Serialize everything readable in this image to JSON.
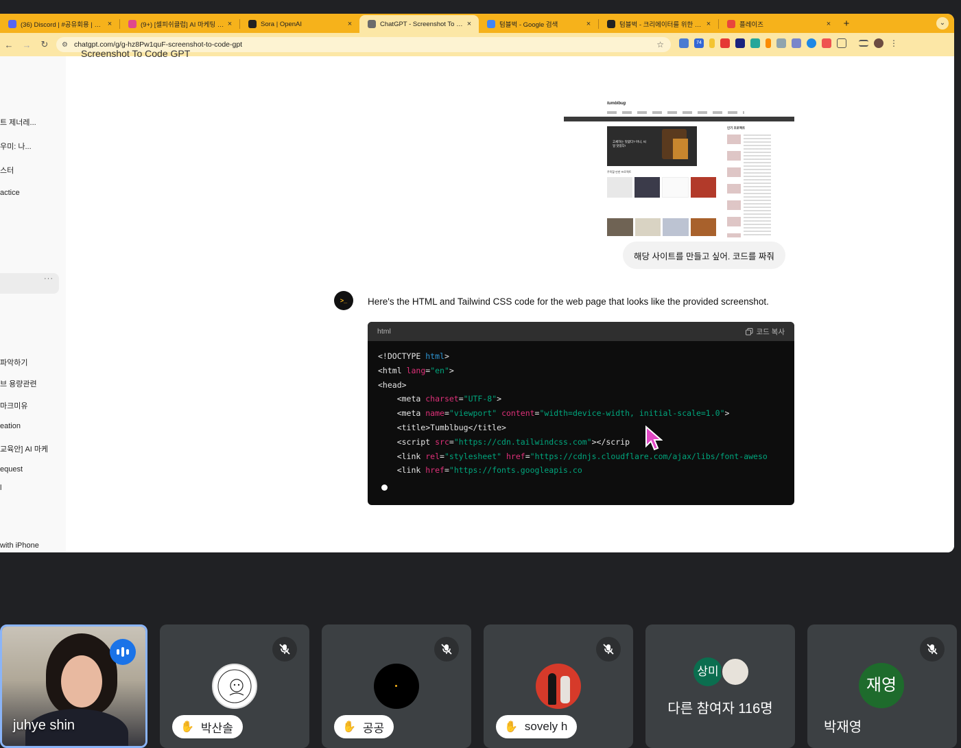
{
  "browser": {
    "tabs": [
      {
        "label": "(36) Discord | #공유회용 | 셀피...",
        "color": "#5865f2"
      },
      {
        "label": "(9+) [셀피쉬클럽] AI 마케팅 뉴진...",
        "color": "#e0488b"
      },
      {
        "label": "Sora | OpenAI",
        "color": "#222222"
      },
      {
        "label": "ChatGPT - Screenshot To Co...",
        "color": "#6b6b6b"
      },
      {
        "label": "텀블벅 - Google 검색",
        "color": "#4285f4"
      },
      {
        "label": "텀블벅 - 크리에이터를 위한 크라우...",
        "color": "#222222"
      },
      {
        "label": "플레이즈",
        "color": "#e8453c"
      }
    ],
    "active_tab_index": 3,
    "close_glyph": "×",
    "new_tab_glyph": "+",
    "url": "chatgpt.com/g/g-hz8Pw1quF-screenshot-to-code-gpt",
    "ext_badge": "74"
  },
  "chat": {
    "title_partial": "Screenshot To Code GPT",
    "sidebar_items": [
      "트 제너레...",
      "우미: 나...",
      "스터",
      "actice",
      "파악하기",
      "브 용량관련",
      "마크미유",
      "eation",
      "교육안] AI 마케",
      "equest",
      "l",
      "with iPhone"
    ],
    "sidebar_dots": "···",
    "user_message": "해당 사이트를 만들고 싶어. 코드를 짜줘",
    "assistant_text": "Here's the HTML and Tailwind CSS code for the web page that looks like the provided screenshot.",
    "avatar_glyph": ">_",
    "code_lang": "html",
    "code_copy": "코드 복사",
    "code_lines": [
      [
        {
          "t": "<!DOCTYPE ",
          "c": "tg"
        },
        {
          "t": "html",
          "c": "kw"
        },
        {
          "t": ">",
          "c": "tg"
        }
      ],
      [
        {
          "t": "<html ",
          "c": "tg"
        },
        {
          "t": "lang",
          "c": "at"
        },
        {
          "t": "=",
          "c": "tg"
        },
        {
          "t": "\"en\"",
          "c": "st"
        },
        {
          "t": ">",
          "c": "tg"
        }
      ],
      [
        {
          "t": "<head>",
          "c": "tg"
        }
      ],
      [
        {
          "t": "    <meta ",
          "c": "tg"
        },
        {
          "t": "charset",
          "c": "at"
        },
        {
          "t": "=",
          "c": "tg"
        },
        {
          "t": "\"UTF-8\"",
          "c": "st"
        },
        {
          "t": ">",
          "c": "tg"
        }
      ],
      [
        {
          "t": "    <meta ",
          "c": "tg"
        },
        {
          "t": "name",
          "c": "at"
        },
        {
          "t": "=",
          "c": "tg"
        },
        {
          "t": "\"viewport\"",
          "c": "st"
        },
        {
          "t": " ",
          "c": "tg"
        },
        {
          "t": "content",
          "c": "at"
        },
        {
          "t": "=",
          "c": "tg"
        },
        {
          "t": "\"width=device-width, initial-scale=1.0\"",
          "c": "st"
        },
        {
          "t": ">",
          "c": "tg"
        }
      ],
      [
        {
          "t": "    <title>Tumblbug</title>",
          "c": "tg"
        }
      ],
      [
        {
          "t": "    <script ",
          "c": "tg"
        },
        {
          "t": "src",
          "c": "at"
        },
        {
          "t": "=",
          "c": "tg"
        },
        {
          "t": "\"https://cdn.tailwindcss.com\"",
          "c": "st"
        },
        {
          "t": "></scrip",
          "c": "tg"
        }
      ],
      [
        {
          "t": "    <link ",
          "c": "tg"
        },
        {
          "t": "rel",
          "c": "at"
        },
        {
          "t": "=",
          "c": "tg"
        },
        {
          "t": "\"stylesheet\"",
          "c": "st"
        },
        {
          "t": " ",
          "c": "tg"
        },
        {
          "t": "href",
          "c": "at"
        },
        {
          "t": "=",
          "c": "tg"
        },
        {
          "t": "\"https://cdnjs.cloudflare.com/ajax/libs/font-aweso",
          "c": "st"
        }
      ],
      [
        {
          "t": "    <link ",
          "c": "tg"
        },
        {
          "t": "href",
          "c": "at"
        },
        {
          "t": "=",
          "c": "tg"
        },
        {
          "t": "\"https://fonts.googleapis.co",
          "c": "st"
        }
      ]
    ],
    "shot": {
      "logo": "tumblbug",
      "banner_text": "고세하는 맛없다? 아니, 씨일 맛었다!",
      "section_title": "주목할 만한 프로젝트",
      "side_title": "인기 프로젝트"
    }
  },
  "meet": {
    "tiles": [
      {
        "name": "juhye shin",
        "type": "video",
        "speaking": true
      },
      {
        "name": "박산솔",
        "type": "avatar",
        "hand": true,
        "muted": true
      },
      {
        "name": "공공",
        "type": "avatar",
        "hand": true,
        "muted": true
      },
      {
        "name": "sovely h",
        "type": "avatar",
        "hand": true,
        "muted": true
      },
      {
        "name": "다른 참여자 116명",
        "type": "group",
        "initial": "상미"
      },
      {
        "name": "박재영",
        "type": "initial",
        "initial": "재영",
        "muted": true
      }
    ],
    "colors": {
      "tile_bg": "#3c4043",
      "speaking_border": "#8ab4f8",
      "speaking_badge": "#1a73e8",
      "initial_bg": "#1e6b2c"
    }
  }
}
